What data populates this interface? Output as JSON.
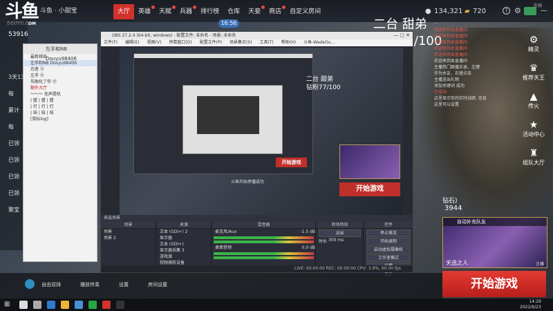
{
  "header": {
    "logo_text": "斗鱼",
    "logo_sub": "DOUYU.COM",
    "breadcrumb": "斗鱼 · 小甜宝",
    "tabs": [
      {
        "label": "大厅",
        "active": true
      },
      {
        "label": "英雄",
        "dot": true
      },
      {
        "label": "天赋",
        "dot": true
      },
      {
        "label": "兵器",
        "dot": true
      },
      {
        "label": "排行榜"
      },
      {
        "label": "仓库"
      },
      {
        "label": "天妾",
        "dot": true
      },
      {
        "label": "商店",
        "dot": true
      },
      {
        "label": "自定义房间"
      }
    ],
    "coins": "134,321",
    "gold": "720",
    "timer": "16:56",
    "online_label": "在线"
  },
  "overlay": {
    "title": "二台 甜弟",
    "progress_text": "钻粉77/100",
    "progress_value": 0.77
  },
  "left": {
    "room_id": "53916",
    "rows": [
      "3天13",
      "每",
      "累计",
      "每",
      "已领",
      "已领",
      "已领",
      "已领",
      "聚宝"
    ]
  },
  "chat_panel": {
    "title": "左手和NB Douyu98406",
    "items": [
      {
        "text": "最新棋局",
        "cls": ""
      },
      {
        "text": "左手和NB Douyu98406",
        "cls": "sel"
      },
      {
        "text": "忍者 ⑪",
        "cls": ""
      },
      {
        "text": "左手 ⑪",
        "cls": ""
      },
      {
        "text": "先融化了你 ⑪",
        "cls": ""
      },
      {
        "text": "额外大厅",
        "cls": "red"
      },
      {
        "text": "～～～ 无声提机",
        "cls": ""
      },
      {
        "text": "| 盟 | 盟 | 盟",
        "cls": ""
      },
      {
        "text": "| 打 | 打 | 打",
        "cls": ""
      },
      {
        "text": "| 结 | 结 | 结",
        "cls": ""
      },
      {
        "text": "[鼠标log]",
        "cls": ""
      }
    ]
  },
  "obs": {
    "title": "OBS 27.2.4 (64-bit, windows) - 配置文件: 未命名 - 场景: 未命名",
    "menu": [
      "文件(F)",
      "编辑(E)",
      "视图(V)",
      "停靠窗口(D)",
      "配置文件(P)",
      "场景集合(S)",
      "工具(T)",
      "帮助(H)",
      "斗鱼-WadeOu..."
    ],
    "preview_title": "二台 甜弟",
    "preview_progress": "钻粉77/100",
    "preview_start": "开始游戏",
    "inner_start": "开始游戏",
    "tip": "斗鱼开始停播成功",
    "dock": {
      "scenes_header": "场景",
      "scenes": [
        "场景",
        "场景 2"
      ],
      "sources_header": "来源",
      "sources": [
        "文本 (GDI+) 2",
        "显示器",
        "文本 (GDI+)",
        "显示器采集 3",
        "游戏源",
        "视频捕获设备"
      ],
      "mixer_header": "混音器",
      "mixer": [
        {
          "label": "麦克风/Aux",
          "db": "-1.5 dB"
        },
        {
          "label": "桌面音频",
          "db": "0.0 dB"
        }
      ],
      "transition_header": "转场特效",
      "transition_value": "淡出",
      "duration_label": "时长",
      "duration_value": "300 ms",
      "controls_header": "控件",
      "controls": [
        "停止推流",
        "开始录制",
        "启动虚拟摄像机",
        "工作室模式",
        "设置",
        "退出"
      ],
      "source_panel_label": "来选场景"
    },
    "status": "LIVE: 00:00:00   REC: 00:00:00   CPU: 3.9%, 60.00 fps"
  },
  "right_chat": [
    {
      "text": "···",
      "cls": ""
    },
    {
      "text": "欢迎来到本直播间",
      "cls": "red"
    },
    {
      "text": "欢迎来到本直播间",
      "cls": "red"
    },
    {
      "text": "欢迎来到本直播间",
      "cls": "red"
    },
    {
      "text": "欢迎来到本直播间",
      "cls": "red"
    },
    {
      "text": "欢迎来到本直播间",
      "cls": "red"
    },
    {
      "text": "欢迎来到本直播间",
      "cls": ""
    },
    {
      "text": "主播热门跟播实录，左键",
      "cls": ""
    },
    {
      "text": "作为水友，右键点击",
      "cls": ""
    },
    {
      "text": "主播送出礼物",
      "cls": ""
    },
    {
      "text": "添加关键词 成功",
      "cls": ""
    },
    {
      "text": "",
      "cls": ""
    },
    {
      "text": "已成功",
      "cls": "red"
    },
    {
      "text": "",
      "cls": ""
    },
    {
      "text": "",
      "cls": ""
    },
    {
      "text": "",
      "cls": ""
    },
    {
      "text": "这里显示你的实时战绩, 信息",
      "cls": ""
    },
    {
      "text": "这里可以设置",
      "cls": ""
    }
  ],
  "right_nav": [
    {
      "label": "精灵",
      "icon": "⚙"
    },
    {
      "label": "推荐天王",
      "icon": "♛"
    },
    {
      "label": "传火",
      "icon": "▲"
    },
    {
      "label": "活动中心",
      "icon": "★"
    },
    {
      "label": "组队大厅",
      "icon": "♜"
    }
  ],
  "fans": {
    "label": "钻石)",
    "count": "3944"
  },
  "card": {
    "header": "自动补充队友",
    "name": "天选之人",
    "level": "三排"
  },
  "start_button": "开始游戏",
  "bottom_bar": {
    "items": [
      "自由双排",
      "播放伴奏",
      "设置",
      "房间设置"
    ]
  },
  "taskbar": {
    "time": "14:29",
    "date": "2022/6/23"
  },
  "colors": {
    "accent": "#d2322d",
    "start": "#c0302a",
    "blue": "#3b6fb5"
  }
}
